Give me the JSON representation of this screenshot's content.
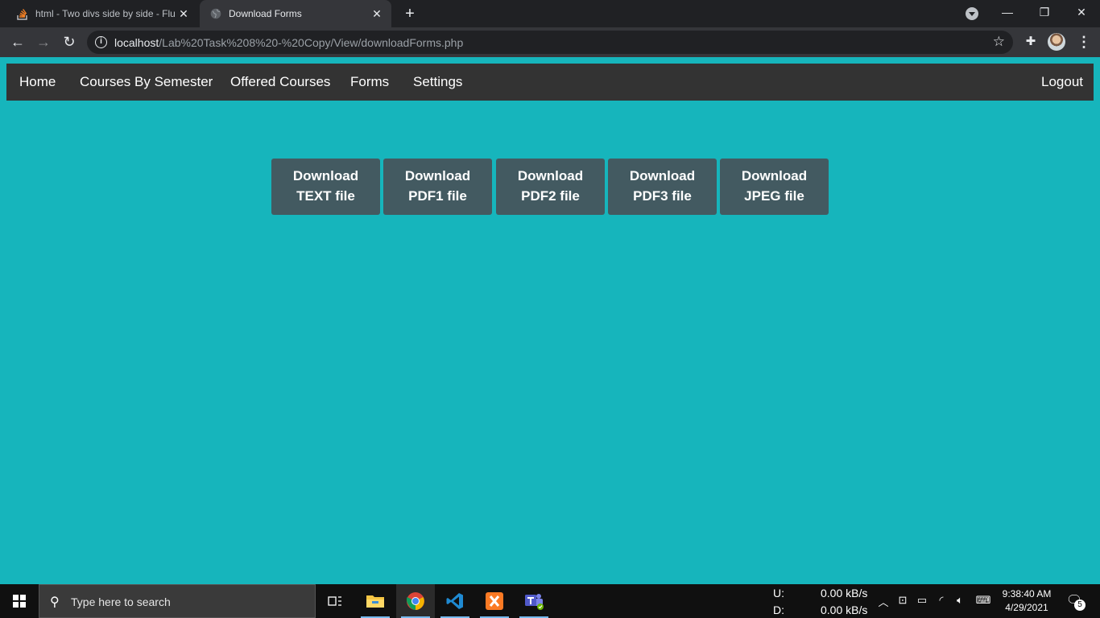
{
  "browser": {
    "tabs": [
      {
        "title": "html - Two divs side by side - Flu",
        "icon": "stackoverflow-icon"
      },
      {
        "title": "Download Forms",
        "icon": "globe-icon"
      }
    ],
    "address": {
      "host": "localhost",
      "path": "/Lab%20Task%208%20-%20Copy/View/downloadForms.php"
    }
  },
  "navbar": {
    "links": [
      "Home",
      "Courses By Semester",
      "Offered Courses",
      "Forms",
      "Settings"
    ],
    "logout": "Logout"
  },
  "downloads": [
    {
      "line1": "Download",
      "line2": "TEXT file"
    },
    {
      "line1": "Download",
      "line2": "PDF1 file"
    },
    {
      "line1": "Download",
      "line2": "PDF2 file"
    },
    {
      "line1": "Download",
      "line2": "PDF3 file"
    },
    {
      "line1": "Download",
      "line2": "JPEG file"
    }
  ],
  "colors": {
    "page_bg": "#16b5bc",
    "navbar_bg": "#333333",
    "button_bg": "#435a61"
  },
  "taskbar": {
    "search_placeholder": "Type here to search",
    "apps": [
      "task-view-icon",
      "file-explorer-icon",
      "chrome-icon",
      "vscode-icon",
      "xampp-icon",
      "teams-icon"
    ],
    "net_upload_label": "U:",
    "net_download_label": "D:",
    "net_upload_speed": "0.00 kB/s",
    "net_download_speed": "0.00 kB/s",
    "time": "9:38:40 AM",
    "date": "4/29/2021",
    "notification_count": "5"
  }
}
